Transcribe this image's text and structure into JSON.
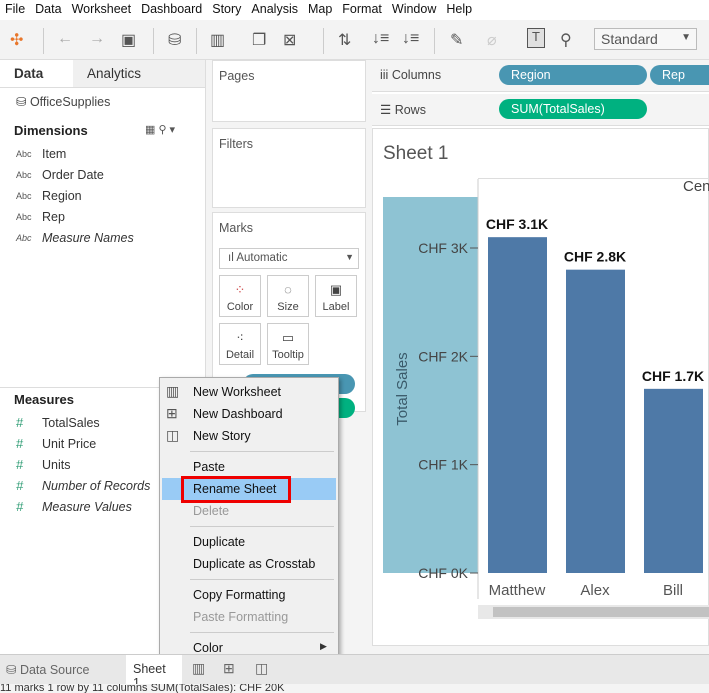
{
  "menu": [
    "File",
    "Data",
    "Worksheet",
    "Dashboard",
    "Story",
    "Analysis",
    "Map",
    "Format",
    "Window",
    "Help"
  ],
  "toolbar": {
    "fit": "Standard"
  },
  "left": {
    "tabs": [
      "Data",
      "Analytics"
    ],
    "datasource": "OfficeSupplies",
    "dimensions_title": "Dimensions",
    "dimensions": [
      {
        "type": "Abc",
        "name": "Item"
      },
      {
        "type": "Abc",
        "name": "Order Date"
      },
      {
        "type": "Abc",
        "name": "Region"
      },
      {
        "type": "Abc",
        "name": "Rep"
      },
      {
        "type": "Abc",
        "name": "Measure Names"
      }
    ],
    "measures_title": "Measures",
    "measures": [
      {
        "type": "#",
        "name": "TotalSales"
      },
      {
        "type": "#",
        "name": "Unit Price"
      },
      {
        "type": "#",
        "name": "Units"
      },
      {
        "type": "#",
        "name": "Number of Records"
      },
      {
        "type": "#",
        "name": "Measure Values"
      }
    ]
  },
  "cards": {
    "pages": "Pages",
    "filters": "Filters",
    "marks": "Marks",
    "mark_type": "Automatic",
    "buttons": [
      "Color",
      "Size",
      "Label",
      "Detail",
      "Tooltip"
    ]
  },
  "shelves": {
    "columns_label": "Columns",
    "columns": [
      "Region",
      "Rep"
    ],
    "rows_label": "Rows",
    "rows": [
      "SUM(TotalSales)"
    ]
  },
  "sheet": {
    "title": "Sheet 1",
    "header": "Central"
  },
  "chart_data": {
    "type": "bar",
    "categories": [
      "Matthew",
      "Alex",
      "Bill"
    ],
    "values": [
      3100,
      2800,
      1700
    ],
    "data_labels": [
      "CHF 3.1K",
      "CHF 2.8K",
      "CHF 1.7K"
    ],
    "ylabel": "Total Sales",
    "yticks": [
      "CHF 0K",
      "CHF 1K",
      "CHF 2K",
      "CHF 3K"
    ],
    "ylim": [
      0,
      3000
    ],
    "color": "#4e79a7"
  },
  "context_menu": {
    "items": [
      {
        "label": "New Worksheet",
        "icon": "new-worksheet-icon",
        "enabled": true
      },
      {
        "label": "New Dashboard",
        "icon": "new-dashboard-icon",
        "enabled": true
      },
      {
        "label": "New Story",
        "icon": "new-story-icon",
        "enabled": true
      },
      {
        "label": "Paste",
        "enabled": true
      },
      {
        "label": "Rename Sheet",
        "enabled": true,
        "highlighted": true
      },
      {
        "label": "Delete",
        "enabled": false
      },
      {
        "label": "Duplicate",
        "enabled": true
      },
      {
        "label": "Duplicate as Crosstab",
        "enabled": true
      },
      {
        "label": "Copy Formatting",
        "enabled": true
      },
      {
        "label": "Paste Formatting",
        "enabled": false
      },
      {
        "label": "Color",
        "enabled": true,
        "submenu": true
      }
    ]
  },
  "tabs": {
    "datasource": "Data Source",
    "sheet": "Sheet 1"
  },
  "status": "11 marks    1 row by 11 columns    SUM(TotalSales): CHF 20K"
}
